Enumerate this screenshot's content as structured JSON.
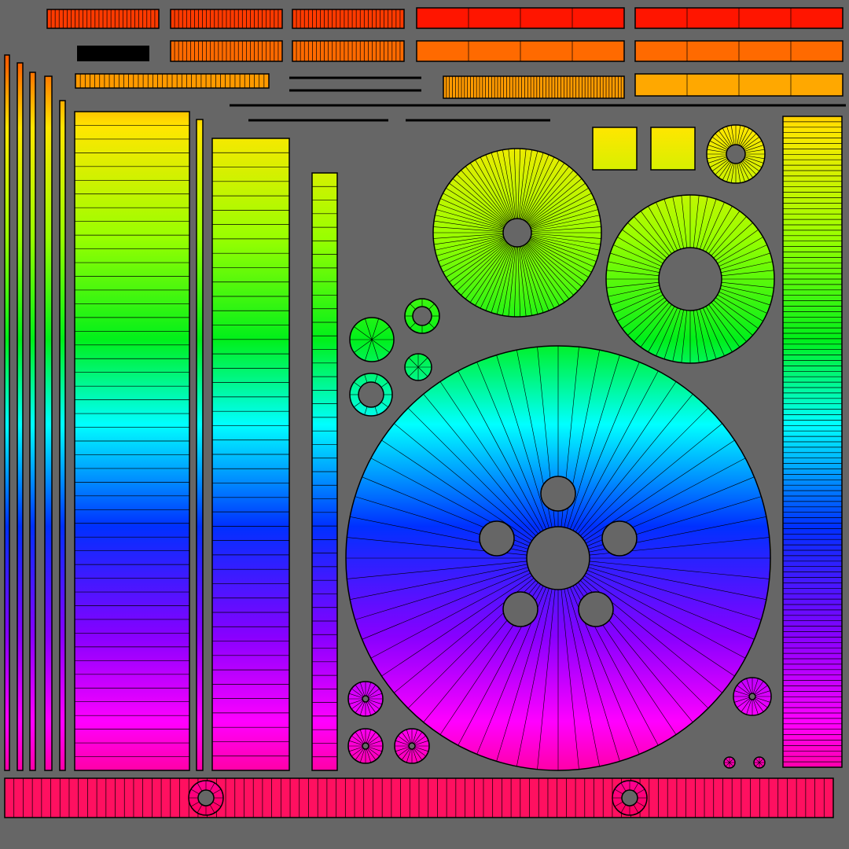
{
  "canvas": {
    "background": "#666666",
    "wire_color": "#000000"
  },
  "gradient": {
    "stops": [
      {
        "offset": 0.0,
        "color": "#ff1500"
      },
      {
        "offset": 0.08,
        "color": "#ff6a00"
      },
      {
        "offset": 0.15,
        "color": "#ffe600"
      },
      {
        "offset": 0.28,
        "color": "#99ff00"
      },
      {
        "offset": 0.4,
        "color": "#00f01a"
      },
      {
        "offset": 0.5,
        "color": "#00ffff"
      },
      {
        "offset": 0.62,
        "color": "#0030ff"
      },
      {
        "offset": 0.75,
        "color": "#8800ff"
      },
      {
        "offset": 0.85,
        "color": "#ff00ff"
      },
      {
        "offset": 0.95,
        "color": "#ff0066"
      }
    ]
  },
  "islands": {
    "strip_count": 23,
    "circle_count": 16,
    "hub_holes": 5
  }
}
